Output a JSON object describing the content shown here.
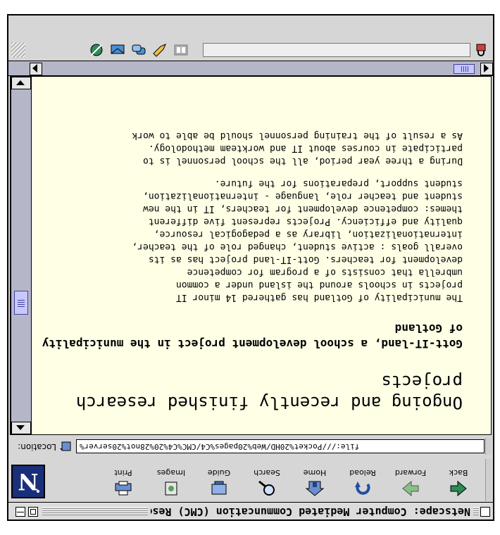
{
  "window": {
    "title": "Netscape: Computer Mediated Communcation (CMC) Resea"
  },
  "toolbar": {
    "buttons": [
      {
        "label": "Back",
        "icon": "back-arrow-icon"
      },
      {
        "label": "Forward",
        "icon": "forward-arrow-icon"
      },
      {
        "label": "Reload",
        "icon": "reload-icon"
      },
      {
        "label": "Home",
        "icon": "home-icon"
      },
      {
        "label": "Search",
        "icon": "search-icon"
      },
      {
        "label": "Guide",
        "icon": "guide-icon"
      },
      {
        "label": "Images",
        "icon": "images-icon"
      },
      {
        "label": "Print",
        "icon": "print-icon"
      }
    ],
    "logo_letter": "N"
  },
  "location": {
    "label": "Location:",
    "url": "file:///Pocket%20HD/Web%20pages%C4/CMC%C4%20%28not%20server%"
  },
  "page": {
    "heading1": "Ongoing and recently finished research projects",
    "heading2": "Gott-IT-land, a school development project in the municipality of Gotland",
    "paragraph1": "The municipality of Gotland has gathered 14 minor IT\nprojects in schools around the island under a common\numbrella that consists of a program for competence\ndevelopment for teachers. Gott-IT-land project has as its\noverall goals : active student, changed role of the teacher,\ninternationalization, library as a pedagogical resource,\nquality and efficiency. Projects represent five different\nthemes: competence development for teachers, IT in the new\nstudent and teacher role, language - internationalization,\nstudent support, preparations for the future.",
    "paragraph2": "During a three year period, all the school personnel is to\nparticipate in courses about IT and workteam methodology.\nAs a result of the training personnel should be able to work"
  },
  "colors": {
    "page_background": "#ffffe6",
    "scrollbar_track": "#b6b6c9",
    "scroll_thumb": "#c8c8ff",
    "logo_background": "#1a2f7a"
  }
}
